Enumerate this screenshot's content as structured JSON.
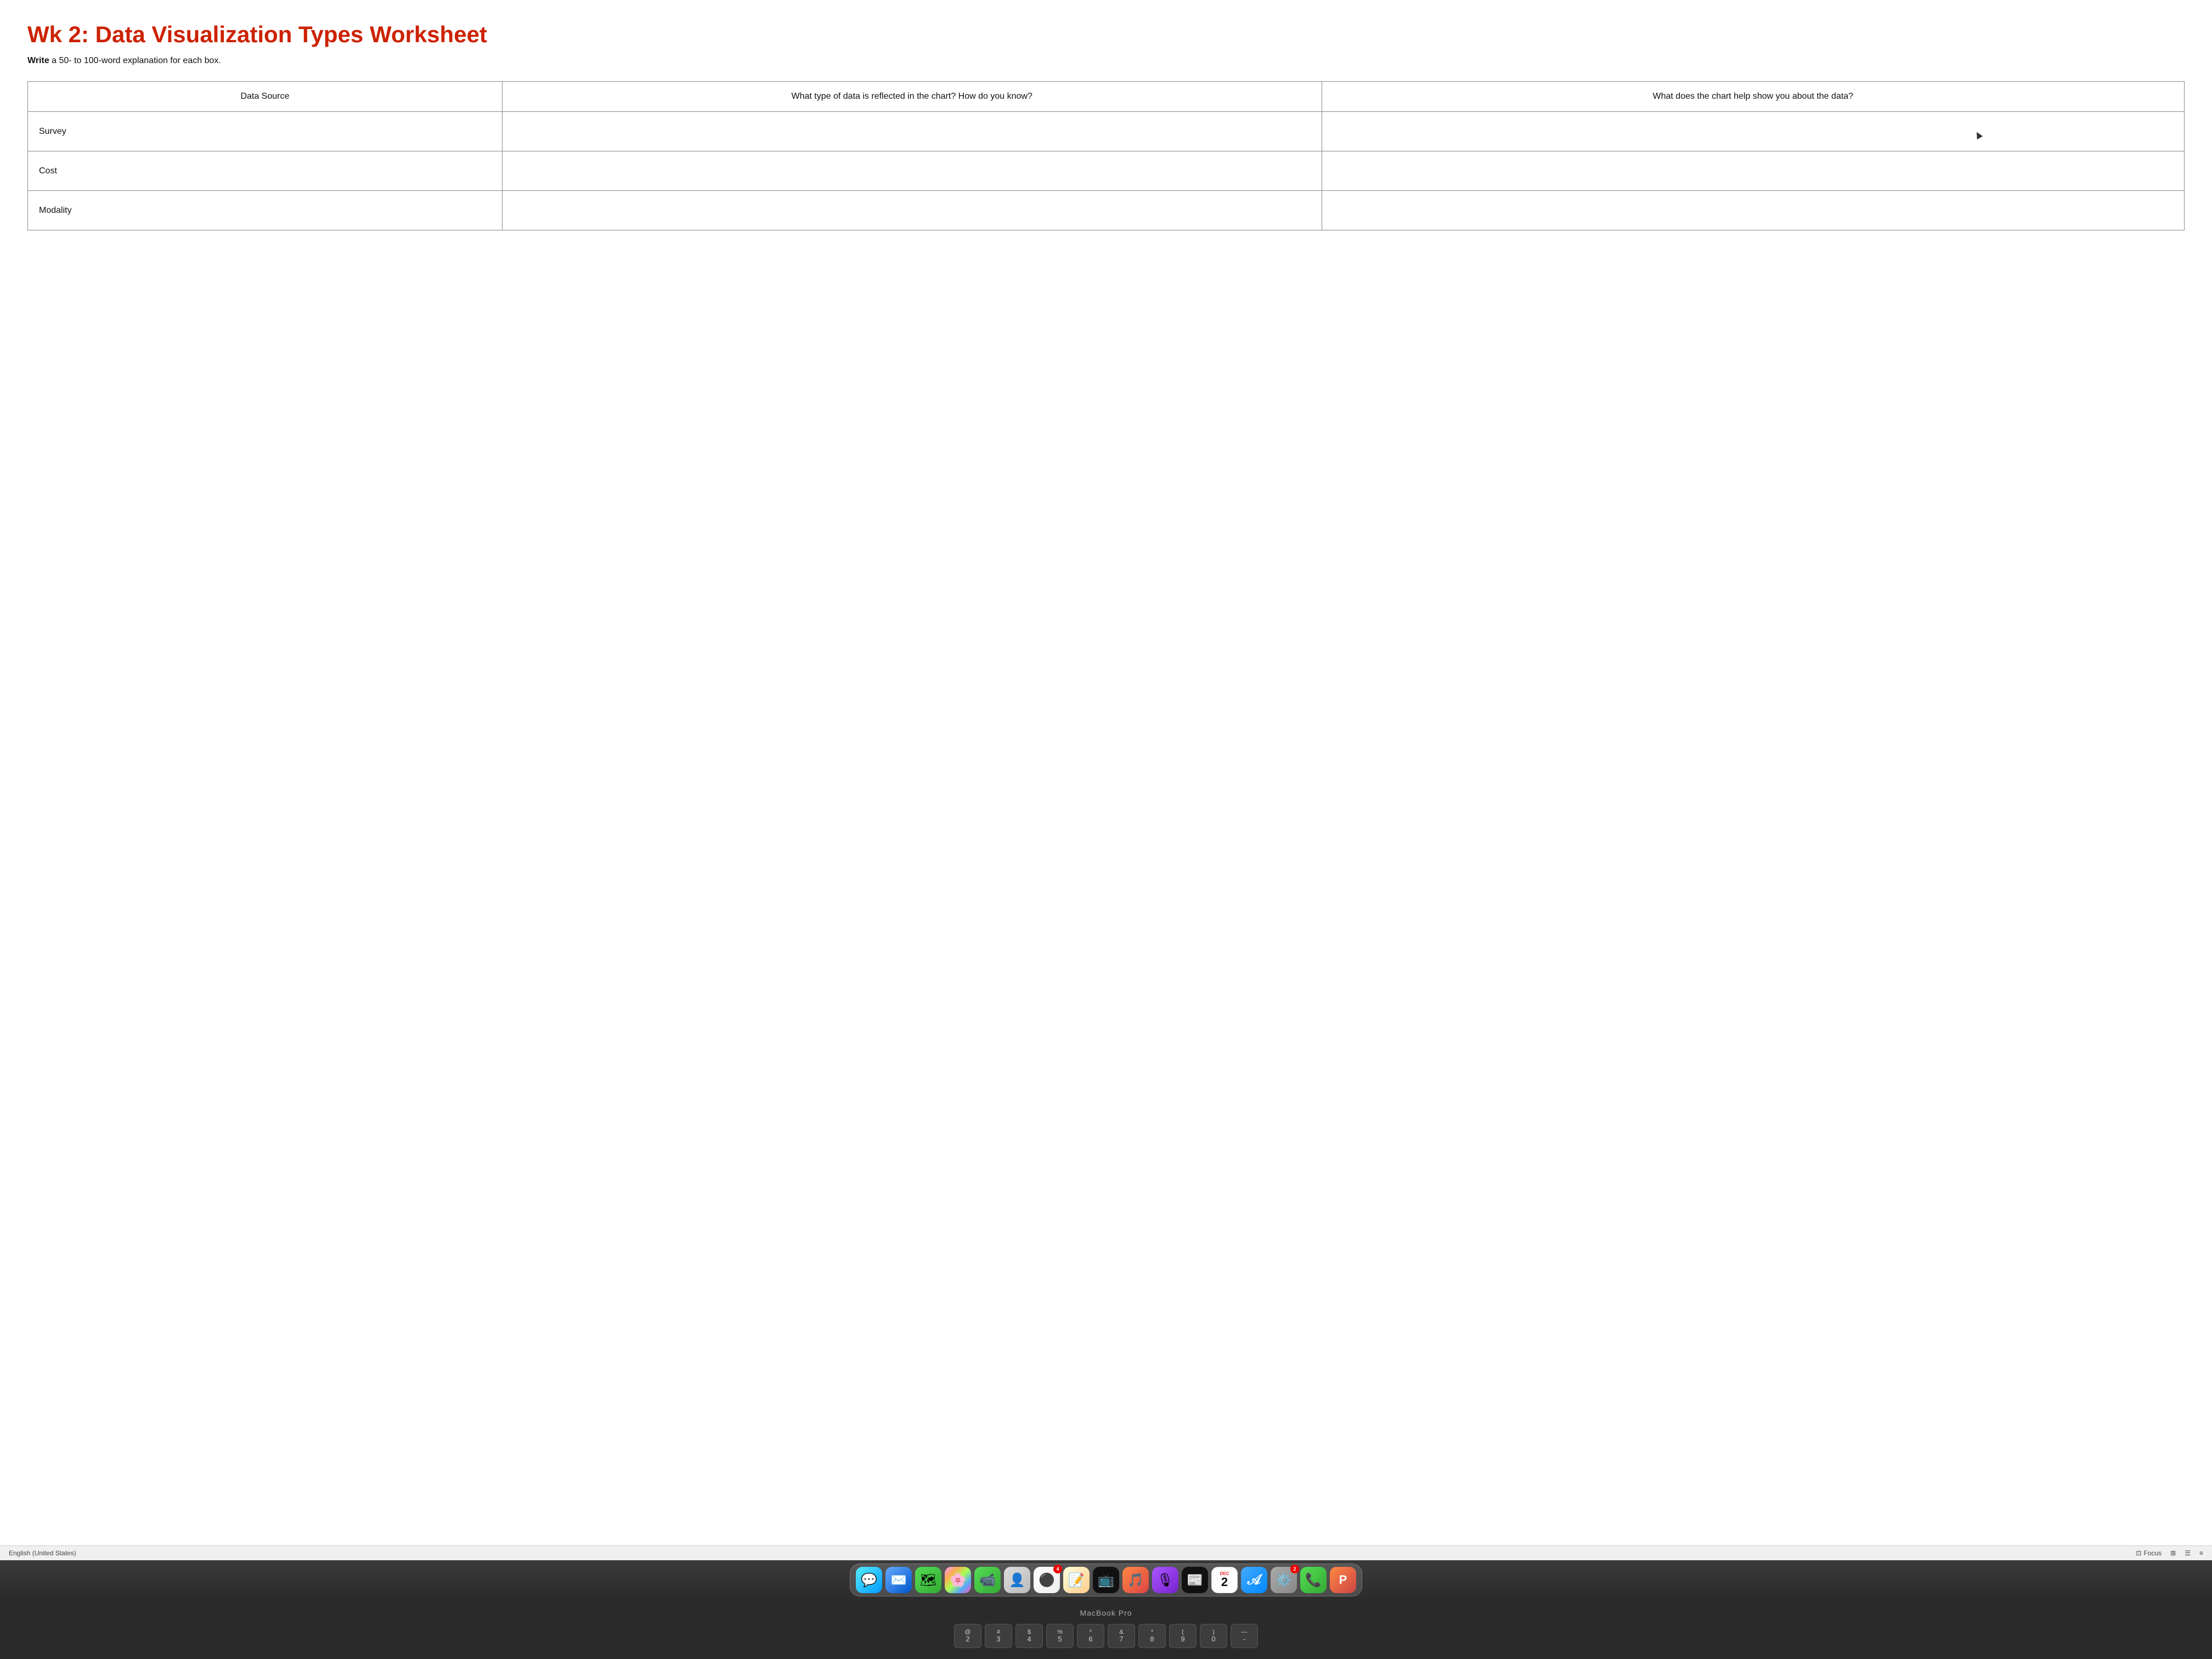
{
  "document": {
    "title": "Wk 2: Data Visualization Types Worksheet",
    "instruction_bold": "Write",
    "instruction_rest": " a 50- to 100-word explanation for each box.",
    "table": {
      "headers": [
        "Data Source",
        "What type of data is reflected in the chart? How do you know?",
        "What does the chart help show you about the data?"
      ],
      "rows": [
        {
          "source": "Survey",
          "type": "",
          "help": ""
        },
        {
          "source": "Cost",
          "type": "",
          "help": ""
        },
        {
          "source": "Modality",
          "type": "",
          "help": ""
        }
      ]
    }
  },
  "status_bar": {
    "language": "English (United States)",
    "focus_label": "Focus",
    "icons": [
      "focus-icon",
      "grid-icon",
      "list-icon",
      "menu-icon"
    ]
  },
  "dock": {
    "macbook_label": "MacBook Pro",
    "apps": [
      {
        "name": "Messages",
        "icon_class": "icon-messages",
        "emoji": "💬",
        "badge": null
      },
      {
        "name": "Mail",
        "icon_class": "icon-mail",
        "emoji": "✉️",
        "badge": null
      },
      {
        "name": "Maps",
        "icon_class": "icon-maps",
        "emoji": "🗺",
        "badge": null
      },
      {
        "name": "Photos",
        "icon_class": "icon-photos",
        "emoji": "🌸",
        "badge": null
      },
      {
        "name": "FaceTime",
        "icon_class": "icon-facetime",
        "emoji": "📹",
        "badge": null
      },
      {
        "name": "Contacts",
        "icon_class": "icon-contacts",
        "emoji": "👤",
        "badge": null
      },
      {
        "name": "Reminders",
        "icon_class": "icon-reminders",
        "emoji": "⚫",
        "badge": "4"
      },
      {
        "name": "Notes",
        "icon_class": "icon-notes",
        "emoji": "📝",
        "badge": null
      },
      {
        "name": "Apple TV",
        "icon_class": "icon-appletv",
        "emoji": "📺",
        "badge": null
      },
      {
        "name": "Music",
        "icon_class": "icon-music",
        "emoji": "🎵",
        "badge": null
      },
      {
        "name": "Podcasts",
        "icon_class": "icon-podcasts",
        "emoji": "🎙",
        "badge": null
      },
      {
        "name": "News",
        "icon_class": "icon-news",
        "emoji": "📰",
        "badge": null
      },
      {
        "name": "Calendar",
        "icon_class": "icon-calendar",
        "emoji": "2",
        "badge": null,
        "month": "DEC"
      },
      {
        "name": "App Store",
        "icon_class": "icon-appstore",
        "emoji": "A",
        "badge": null
      },
      {
        "name": "Settings",
        "icon_class": "icon-settings",
        "emoji": "⚙️",
        "badge": "2"
      },
      {
        "name": "WhatsApp",
        "icon_class": "icon-whatsapp",
        "emoji": "📞",
        "badge": null
      },
      {
        "name": "PowerPoint",
        "icon_class": "icon-powerpoint",
        "emoji": "P",
        "badge": null
      }
    ]
  },
  "keyboard": {
    "keys": [
      {
        "top": "@",
        "bottom": "2"
      },
      {
        "top": "#",
        "bottom": "3"
      },
      {
        "top": "$",
        "bottom": "4"
      },
      {
        "top": "%",
        "bottom": "5"
      },
      {
        "top": "^",
        "bottom": "6"
      },
      {
        "top": "&",
        "bottom": "7"
      },
      {
        "top": "*",
        "bottom": "8"
      },
      {
        "top": "(",
        "bottom": "9"
      },
      {
        "top": ")",
        "bottom": "0"
      },
      {
        "top": "—",
        "bottom": "-"
      }
    ]
  }
}
